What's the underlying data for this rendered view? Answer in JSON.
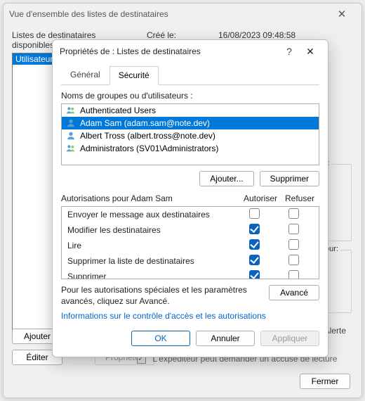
{
  "parent": {
    "title": "Vue d'ensemble des listes de destinataires",
    "available_label": "Listes de destinataires disponibles",
    "created_label": "Créé le:",
    "created_value": "16/08/2023 09:48:58",
    "list_selected": "Utilisateurs",
    "sidebox_r": "r:",
    "sidebox_pour": "our:",
    "alerte_label": "Alerte",
    "btn_ajouter": "Ajouter",
    "btn_editer": "Éditer",
    "btn_proprietes": "Propriétés",
    "receipt_hint": "L'expéditeur peut demander un accusé de lecture",
    "btn_fermer": "Fermer"
  },
  "props": {
    "title": "Propriétés de : Listes de destinataires",
    "tab_general": "Général",
    "tab_security": "Sécurité",
    "group_label": "Noms de groupes ou d'utilisateurs :",
    "principals": [
      {
        "name": "Authenticated Users",
        "type": "group",
        "selected": false
      },
      {
        "name": "Adam Sam (adam.sam@note.dev)",
        "type": "user",
        "selected": true
      },
      {
        "name": "Albert Tross (albert.tross@note.dev)",
        "type": "user",
        "selected": false
      },
      {
        "name": "Administrators (SV01\\Administrators)",
        "type": "group",
        "selected": false
      }
    ],
    "btn_add": "Ajouter...",
    "btn_remove": "Supprimer",
    "perm_for": "Autorisations pour Adam Sam",
    "col_allow": "Autoriser",
    "col_deny": "Refuser",
    "perms": [
      {
        "name": "Envoyer le message aux destinataires",
        "allow": false,
        "deny": false
      },
      {
        "name": "Modifier les destinataires",
        "allow": true,
        "deny": false
      },
      {
        "name": "Lire",
        "allow": true,
        "deny": false
      },
      {
        "name": "Supprimer la liste de destinataires",
        "allow": true,
        "deny": false
      },
      {
        "name": "Supprimer",
        "allow": true,
        "deny": false
      }
    ],
    "adv_text": "Pour les autorisations spéciales et les paramètres avancés, cliquez sur Avancé.",
    "btn_advanced": "Avancé",
    "link_info": "Informations sur le contrôle d'accès et les autorisations",
    "btn_ok": "OK",
    "btn_cancel": "Annuler",
    "btn_apply": "Appliquer"
  }
}
